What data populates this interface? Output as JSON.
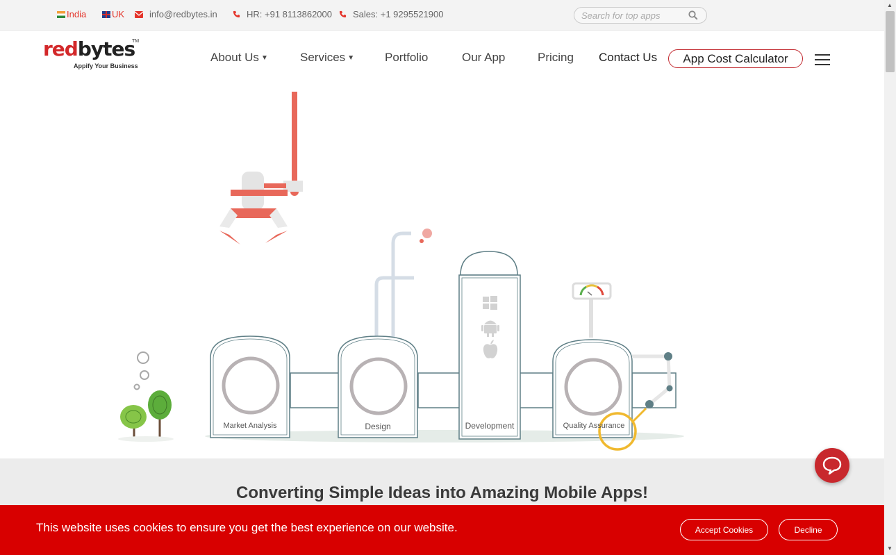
{
  "topbar": {
    "india_label": "India",
    "uk_label": "UK",
    "email": "info@redbytes.in",
    "hr_phone": "HR: +91 8113862000",
    "sales_phone": "Sales: +1 9295521900",
    "search_placeholder": "Search for top apps"
  },
  "logo": {
    "red_part": "red",
    "dark_part": "bytes",
    "tm": "TM",
    "tagline": "Appify Your Business"
  },
  "nav": {
    "items": [
      {
        "label": "About Us"
      },
      {
        "label": "Services"
      },
      {
        "label": "Portfolio"
      },
      {
        "label": "Our App"
      },
      {
        "label": "Pricing"
      },
      {
        "label": "Contact Us"
      }
    ],
    "cta_label": "App Cost Calculator"
  },
  "hero": {
    "stages": [
      {
        "label": "Market Analysis"
      },
      {
        "label": "Design"
      },
      {
        "label": "Development"
      },
      {
        "label": "Quality Assurance"
      }
    ]
  },
  "headline": "Converting Simple Ideas into Amazing Mobile Apps!",
  "cookie": {
    "message": "This website uses cookies to ensure you get the best experience on our website.",
    "accept_label": "Accept Cookies",
    "decline_label": "Decline"
  },
  "colors": {
    "brand_red": "#d3282a",
    "cookie_bg": "#d80000",
    "machine_stroke": "#5f7f86",
    "arm_orange": "#e8685a"
  }
}
